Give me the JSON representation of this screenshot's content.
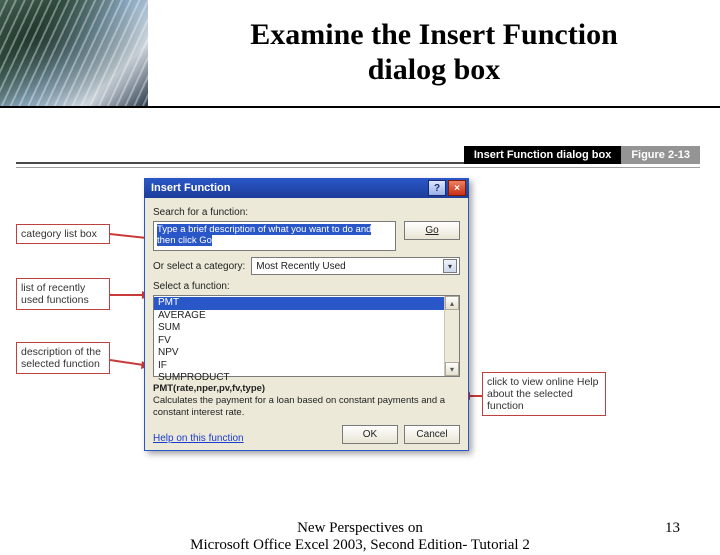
{
  "header": {
    "title_line1": "Examine the Insert Function",
    "title_line2": "dialog box"
  },
  "figure": {
    "caption": "Insert Function dialog box",
    "number": "Figure 2-13"
  },
  "callouts": {
    "category": "category list box",
    "recent": "list of recently used functions",
    "description": "description of the selected function",
    "onlinehelp": "click to view online Help about the selected function"
  },
  "dialog": {
    "title": "Insert Function",
    "help_glyph": "?",
    "close_glyph": "×",
    "search_label": "Search for a function:",
    "search_text": "Type a brief description of what you want to do and then click Go",
    "go": "Go",
    "category_label": "Or select a category:",
    "category_value": "Most Recently Used",
    "select_label": "Select a function:",
    "functions": [
      "PMT",
      "AVERAGE",
      "SUM",
      "FV",
      "NPV",
      "IF",
      "SUMPRODUCT"
    ],
    "syntax": "PMT(rate,nper,pv,fv,type)",
    "description": "Calculates the payment for a loan based on constant payments and a constant interest rate.",
    "help_link": "Help on this function",
    "ok": "OK",
    "cancel": "Cancel"
  },
  "footer": {
    "line1": "New Perspectives on",
    "line2": "Microsoft Office Excel 2003, Second Edition- Tutorial 2",
    "page": "13"
  }
}
